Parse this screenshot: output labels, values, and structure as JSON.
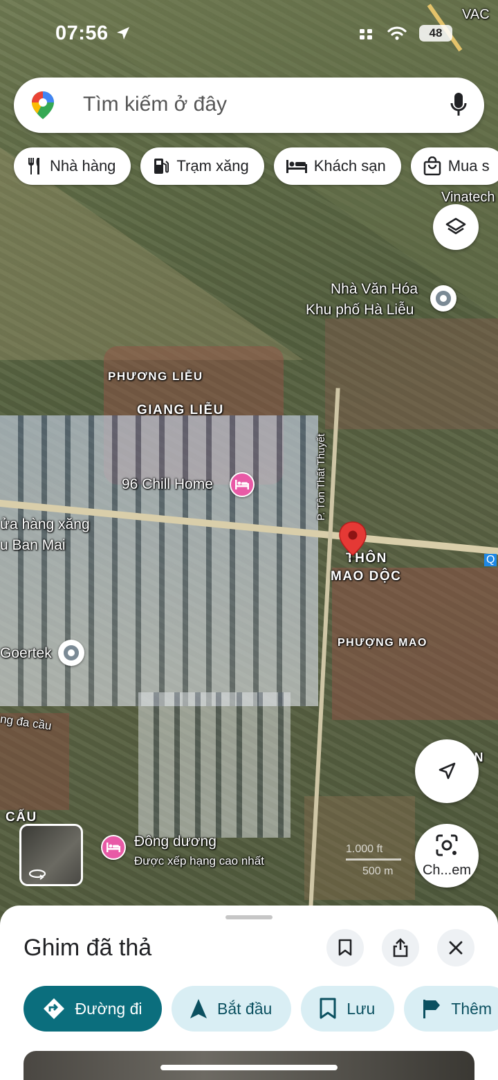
{
  "status_bar": {
    "time": "07:56",
    "battery": "48"
  },
  "search": {
    "placeholder": "Tìm kiếm ở đây"
  },
  "chips": [
    {
      "label": "Nhà hàng",
      "icon": "fork-knife-icon"
    },
    {
      "label": "Trạm xăng",
      "icon": "gas-station-icon"
    },
    {
      "label": "Khách sạn",
      "icon": "bed-icon"
    },
    {
      "label": "Mua s",
      "icon": "shopping-bag-icon"
    }
  ],
  "map": {
    "labels": {
      "vac": "VAC",
      "vinatech": "Vinatech",
      "nha_van_hoa_1": "Nhà Văn Hóa",
      "nha_van_hoa_2": "Khu phố Hà Liễu",
      "phuong_lieu": "PHƯƠNG LIỄU",
      "giang_lieu": "GIANG LIỄU",
      "chill_home": "96 Chill Home",
      "cua_hang_1": "ửa hàng xăng",
      "cua_hang_2": "u Ban Mai",
      "ton_that_thuyet": "P. Tôn Thất Thuyết",
      "thon_1": "THÔN",
      "thon_2": "MAO DỘC",
      "phuong_mao": "PHƯỢNG MAO",
      "goertek": "Goertek",
      "dong_da_cau": "ng đa cầu",
      "en": "ÊN",
      "cau": "CẤU",
      "dong_duong": "Đông dương",
      "dong_duong_sub": "Được xếp hạng cao nhất",
      "q": "Q"
    },
    "scale": {
      "top": "1.000 ft",
      "bottom": "500 m"
    },
    "lens_label": "Ch...em"
  },
  "sheet": {
    "title": "Ghim đã thả",
    "actions": [
      {
        "label": "Đường đi",
        "icon": "directions-icon"
      },
      {
        "label": "Bắt đầu",
        "icon": "navigation-arrow-icon"
      },
      {
        "label": "Lưu",
        "icon": "bookmark-icon"
      },
      {
        "label": "Thêm",
        "icon": "flag-icon"
      }
    ]
  },
  "colors": {
    "primary": "#0b6e7d",
    "action_bg": "#d9eef4",
    "pin_red": "#e53935",
    "hotel_pink": "#e85aa6"
  }
}
